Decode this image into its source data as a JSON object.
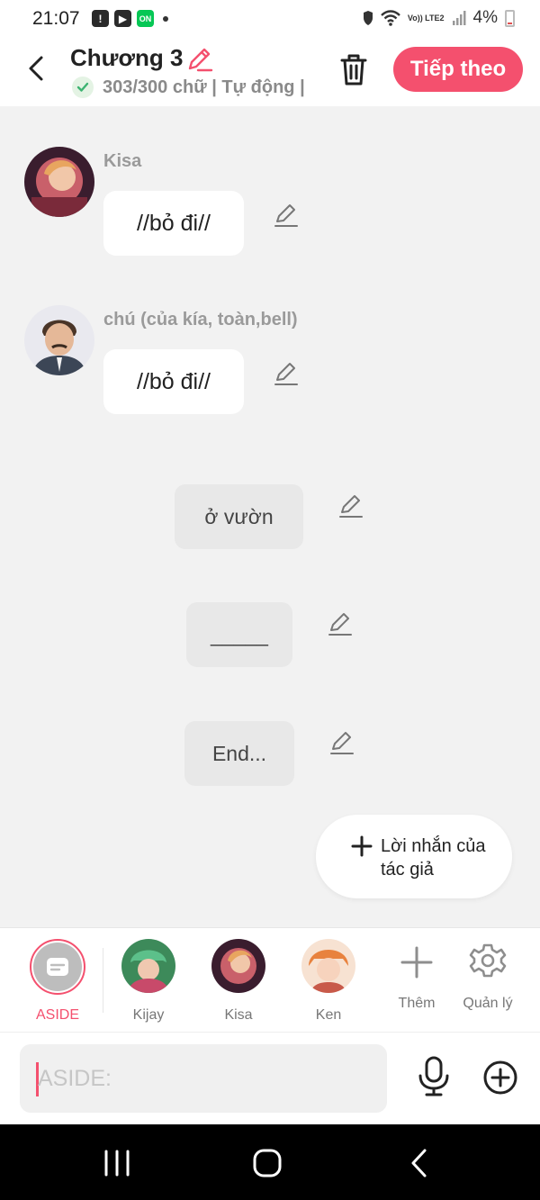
{
  "status_bar": {
    "time": "21:07",
    "battery": "4%",
    "network": "Vo)) LTE2",
    "icons": [
      "alert-icon",
      "play-icon",
      "line-app-icon",
      "dot-icon",
      "vpn-icon",
      "wifi-icon",
      "signal-icon",
      "battery-icon"
    ]
  },
  "header": {
    "title": "Chương 3",
    "word_count": "303/300 chữ | Tự động |",
    "next_label": "Tiếp theo",
    "accent_color": "#f4506e"
  },
  "messages": [
    {
      "type": "character",
      "sender": "Kisa",
      "text": "//bỏ đi//"
    },
    {
      "type": "character",
      "sender": "chú (của kía, toàn,bell)",
      "text": "//bỏ đi//"
    },
    {
      "type": "aside",
      "text": "ở vườn"
    },
    {
      "type": "aside",
      "text": "_____"
    },
    {
      "type": "aside",
      "text": "End..."
    }
  ],
  "author_note": {
    "label": "Lời nhắn của tác giả"
  },
  "characters": [
    {
      "label": "ASIDE",
      "selected": true
    },
    {
      "label": "Kijay"
    },
    {
      "label": "Kisa"
    },
    {
      "label": "Ken"
    },
    {
      "label": "Thêm"
    },
    {
      "label": "Quản lý"
    }
  ],
  "input": {
    "placeholder": "ASIDE:",
    "value": ""
  }
}
